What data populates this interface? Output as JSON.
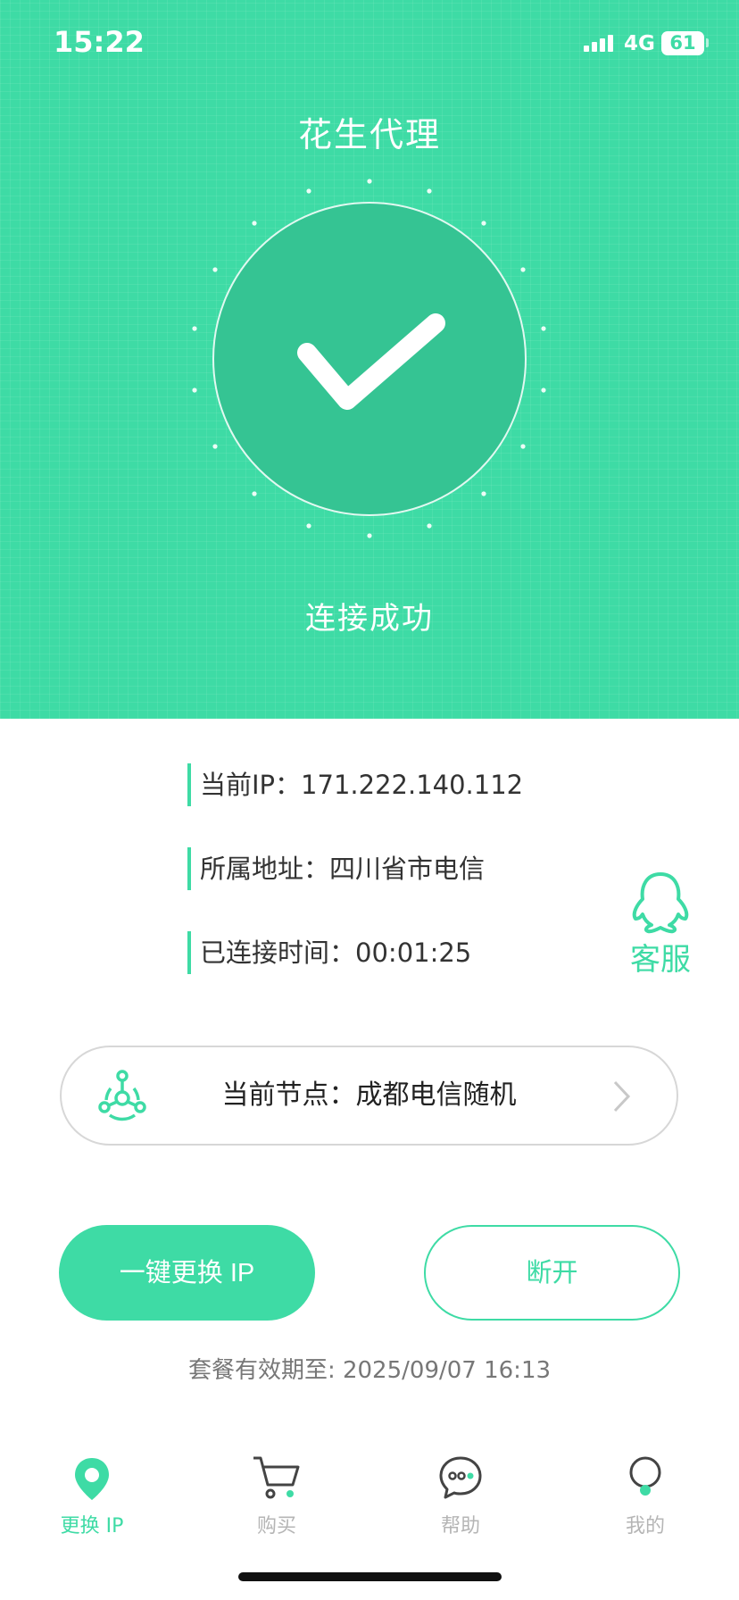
{
  "status_bar": {
    "time": "15:22",
    "network": "4G",
    "battery": "61"
  },
  "app": {
    "title": "花生代理"
  },
  "connection": {
    "status_text": "连接成功"
  },
  "info": {
    "ip_label": "当前IP：",
    "ip_value": "171.222.140.112",
    "address_label": "所属地址：",
    "address_value": "四川省市电信",
    "time_label": "已连接时间：",
    "time_value": "00:01:25"
  },
  "support": {
    "label": "客服"
  },
  "node": {
    "label": "当前节点：",
    "value": "成都电信随机"
  },
  "actions": {
    "switch_label": "一键更换 IP",
    "disconnect_label": "断开"
  },
  "expiry": {
    "text": "套餐有效期至: 2025/09/07 16:13"
  },
  "tabs": [
    {
      "label": "更换 IP",
      "icon": "location-pin-icon",
      "active": true
    },
    {
      "label": "购买",
      "icon": "cart-icon",
      "active": false
    },
    {
      "label": "帮助",
      "icon": "chat-bubble-icon",
      "active": false
    },
    {
      "label": "我的",
      "icon": "person-icon",
      "active": false
    }
  ],
  "colors": {
    "accent": "#3edba5",
    "circle": "#35c493",
    "text": "#333333",
    "inactive": "#b5b5b5"
  }
}
